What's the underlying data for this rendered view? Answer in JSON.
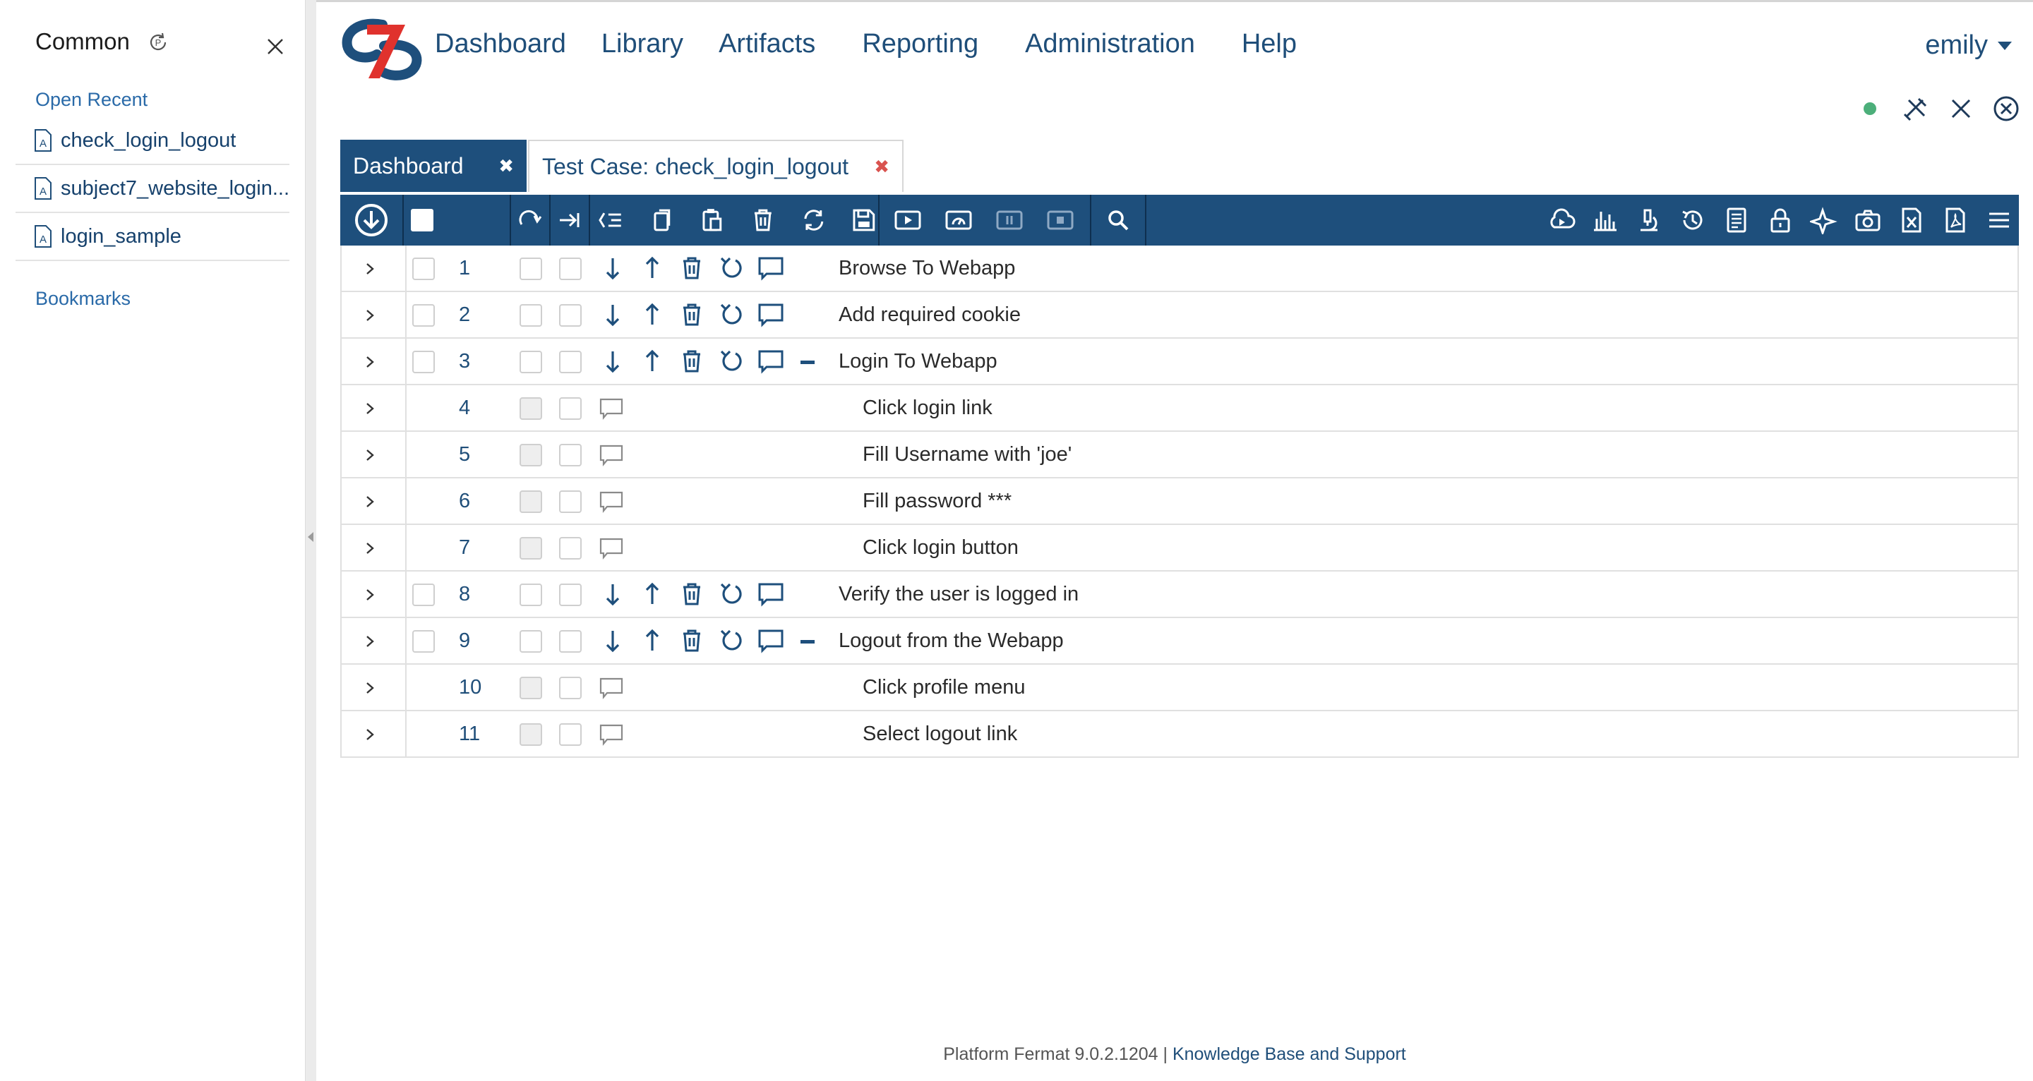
{
  "sidebar": {
    "title": "Common",
    "open_recent": "Open Recent",
    "recent": [
      {
        "label": "check_login_logout"
      },
      {
        "label": "subject7_website_login..."
      },
      {
        "label": "login_sample"
      }
    ],
    "bookmarks": "Bookmarks"
  },
  "nav": {
    "links": [
      "Dashboard",
      "Library",
      "Artifacts",
      "Reporting",
      "Administration",
      "Help"
    ],
    "user": "emily"
  },
  "tabs": [
    {
      "label": "Dashboard",
      "close": "✖",
      "active": true
    },
    {
      "label": "Test Case: check_login_logout",
      "close": "✖",
      "active": false
    }
  ],
  "steps": [
    {
      "num": "1",
      "text": "Browse To Webapp",
      "indent": false,
      "actions": true,
      "collapse": false
    },
    {
      "num": "2",
      "text": "Add required cookie",
      "indent": false,
      "actions": true,
      "collapse": false
    },
    {
      "num": "3",
      "text": "Login To Webapp",
      "indent": false,
      "actions": true,
      "collapse": true
    },
    {
      "num": "4",
      "text": "Click login link",
      "indent": true,
      "actions": false,
      "collapse": false
    },
    {
      "num": "5",
      "text": "Fill Username with 'joe'",
      "indent": true,
      "actions": false,
      "collapse": false
    },
    {
      "num": "6",
      "text": "Fill password ***",
      "indent": true,
      "actions": false,
      "collapse": false
    },
    {
      "num": "7",
      "text": "Click login button",
      "indent": true,
      "actions": false,
      "collapse": false
    },
    {
      "num": "8",
      "text": "Verify the user is logged in",
      "indent": false,
      "actions": true,
      "collapse": false
    },
    {
      "num": "9",
      "text": "Logout from the Webapp",
      "indent": false,
      "actions": true,
      "collapse": true
    },
    {
      "num": "10",
      "text": "Click profile menu",
      "indent": true,
      "actions": false,
      "collapse": false
    },
    {
      "num": "11",
      "text": "Select logout link",
      "indent": true,
      "actions": false,
      "collapse": false
    }
  ],
  "footer": {
    "version": "Platform Fermat 9.0.2.1204",
    "separator": "|",
    "link": "Knowledge Base and Support"
  },
  "colors": {
    "brand_blue": "#1e4f7c",
    "logo_red": "#e0322d",
    "status_ok": "#4caf7a",
    "close_red": "#d9534f"
  },
  "icons": {
    "sidebar": [
      "refresh-p-icon",
      "close-icon",
      "document-icon"
    ],
    "top_tools": [
      "status-dot",
      "tools-icon",
      "close-icon",
      "close-circle-icon"
    ],
    "toolbar_left": [
      "download-circle-icon",
      "select-all-checkbox",
      "redo-icon",
      "skip-icon",
      "list-icon",
      "copy-icon",
      "paste-icon",
      "trash-icon",
      "sync-icon",
      "save-icon",
      "play-icon",
      "run-gauge-icon",
      "pause-icon",
      "stop-icon",
      "search-icon"
    ],
    "toolbar_right": [
      "cloud-play-icon",
      "bar-chart-icon",
      "microscope-icon",
      "history-icon",
      "report-icon",
      "lock-icon",
      "sparkle-icon",
      "camera-icon",
      "excel-icon",
      "pdf-icon",
      "menu-icon"
    ],
    "row_actions": [
      "arrow-down-icon",
      "arrow-up-icon",
      "trash-icon",
      "undo-icon",
      "comment-icon"
    ]
  }
}
